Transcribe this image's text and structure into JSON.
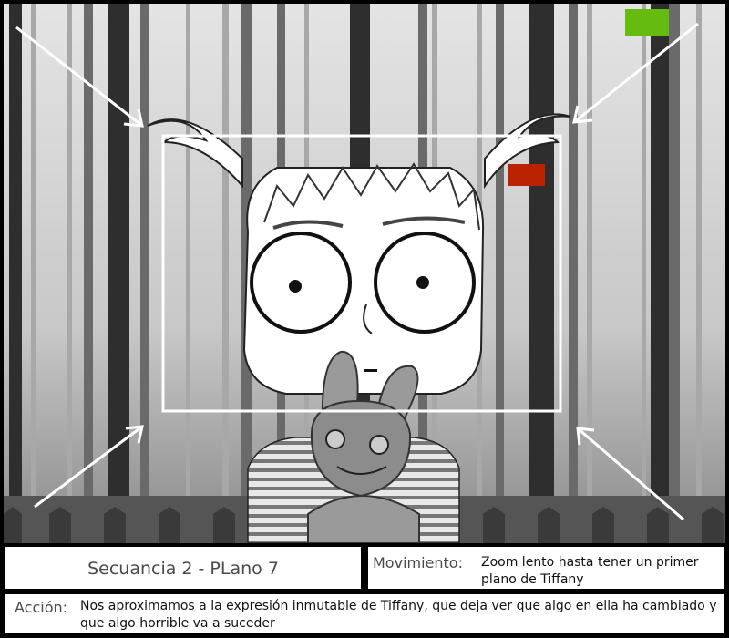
{
  "scene": {
    "marker_colors": {
      "green": "#66bb11",
      "red": "#bb2200"
    }
  },
  "sequence_label": "Secuancia 2 - PLano 7",
  "movement": {
    "label": "Movimiento:",
    "text": "Zoom lento hasta tener un primer plano de Tiffany"
  },
  "action": {
    "label": "Acción:",
    "text": "Nos aproximamos a la expresión inmutable de Tiffany, que deja ver que algo en ella ha cambiado y que algo horrible va a suceder"
  }
}
